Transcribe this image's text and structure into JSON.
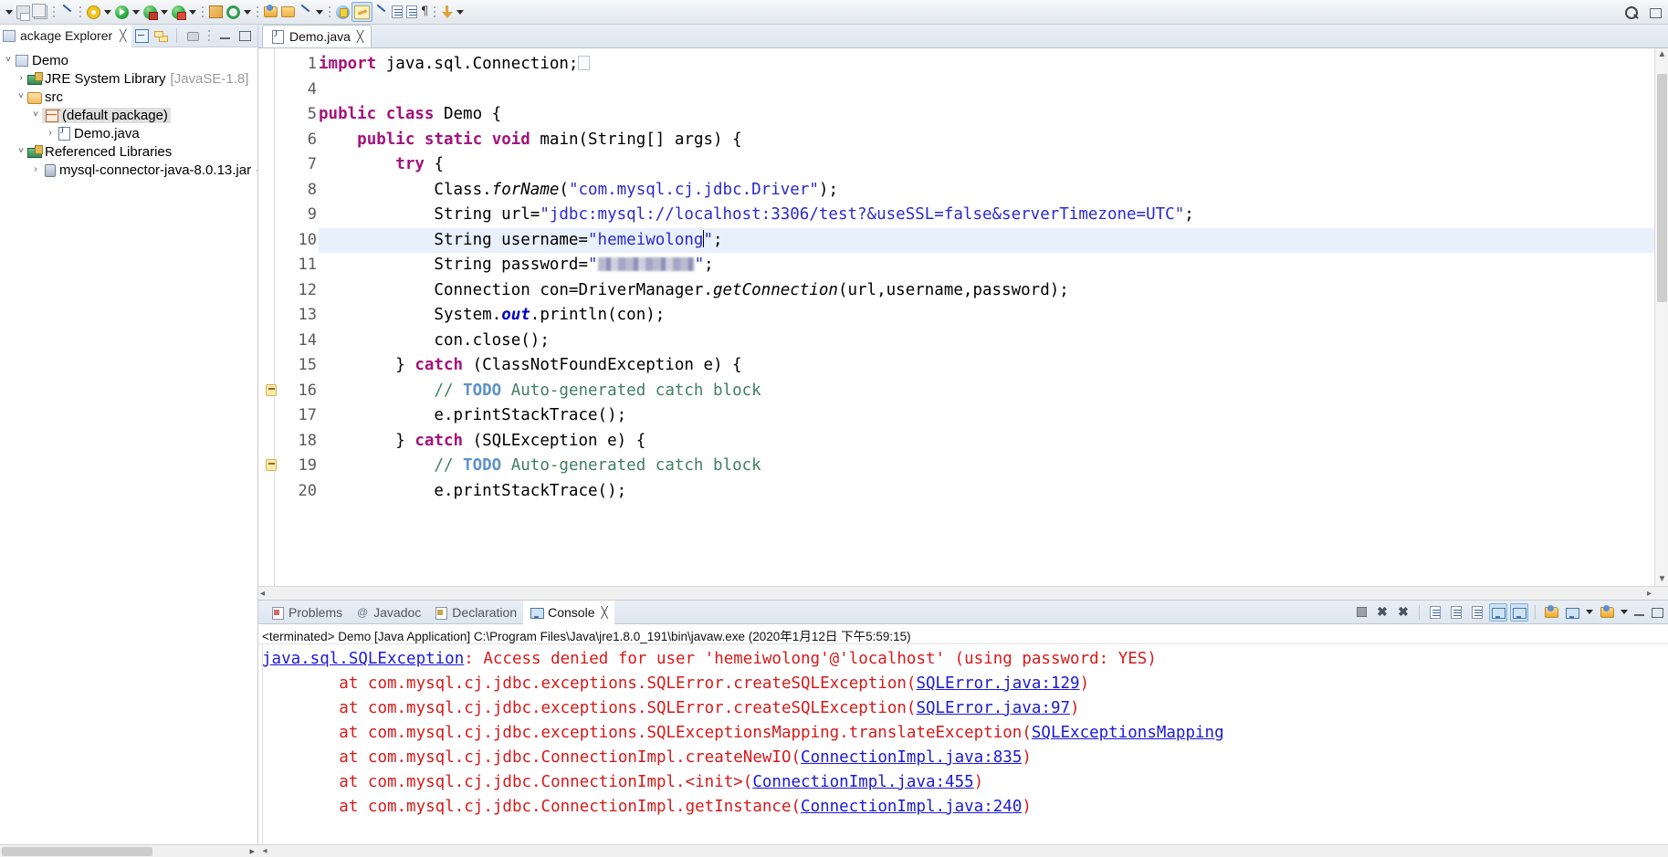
{
  "toolbar": {
    "icons": [
      {
        "name": "save-icon",
        "label": "Save"
      },
      {
        "name": "save-all-icon",
        "label": "Save All"
      },
      {
        "name": "skip-breakpoints-icon",
        "label": "Skip All Breakpoints"
      },
      {
        "name": "debug-icon",
        "label": "Debug"
      },
      {
        "name": "run-icon",
        "label": "Run"
      },
      {
        "name": "run-external-tools-icon",
        "label": "External Tools"
      },
      {
        "name": "coverage-icon",
        "label": "Coverage"
      },
      {
        "name": "new-java-package-icon",
        "label": "New Java Package"
      },
      {
        "name": "refresh-icon",
        "label": "Refresh"
      },
      {
        "name": "open-type-icon",
        "label": "Open Type"
      },
      {
        "name": "open-task-icon",
        "label": "Open Task"
      },
      {
        "name": "new-folder-icon",
        "label": "New Folder"
      },
      {
        "name": "edit-pen-icon",
        "label": "Edit"
      },
      {
        "name": "previous-annotation-icon",
        "label": "Previous Annotation"
      },
      {
        "name": "next-annotation-icon",
        "label": "Next Annotation"
      },
      {
        "name": "toggle-mark-occurrences-icon",
        "label": "Toggle Mark Occurrences"
      },
      {
        "name": "link-with-editor-icon",
        "label": "Link With Editor"
      },
      {
        "name": "show-whitespace-icon",
        "label": "Show Whitespace Characters"
      },
      {
        "name": "block-selection-icon",
        "label": "Block Selection Mode"
      },
      {
        "name": "pilcrow-icon",
        "label": "Show Print Margin"
      },
      {
        "name": "download-icon",
        "label": "Download"
      }
    ],
    "right_icons": [
      {
        "name": "search-icon",
        "label": "Search"
      },
      {
        "name": "perspective-icon",
        "label": "Open Perspective"
      }
    ]
  },
  "package_explorer": {
    "title": "ackage Explorer",
    "close_glyph": "╳",
    "tools": [
      {
        "name": "collapse-all-icon",
        "label": "Collapse All"
      },
      {
        "name": "link-with-editor-icon",
        "label": "Link with Editor"
      },
      {
        "name": "view-menu-icon",
        "label": "View Menu"
      },
      {
        "name": "minimize-icon",
        "label": "Minimize"
      },
      {
        "name": "maximize-icon",
        "label": "Maximize"
      }
    ],
    "tree": [
      {
        "indent": 1,
        "twist": "˅",
        "icon": "project-icon",
        "label": "Demo",
        "muted": "",
        "selected": false
      },
      {
        "indent": 2,
        "twist": "›",
        "icon": "jre-system-library-icon",
        "label": "JRE System Library",
        "muted": "[JavaSE-1.8]",
        "selected": false
      },
      {
        "indent": 2,
        "twist": "˅",
        "icon": "source-folder-icon",
        "label": "src",
        "muted": "",
        "selected": false
      },
      {
        "indent": 3,
        "twist": "˅",
        "icon": "package-icon",
        "label": "(default package)",
        "muted": "",
        "selected": true
      },
      {
        "indent": 4,
        "twist": "›",
        "icon": "java-file-icon",
        "label": "Demo.java",
        "muted": "",
        "selected": false
      },
      {
        "indent": 2,
        "twist": "˅",
        "icon": "referenced-libraries-icon",
        "label": "Referenced Libraries",
        "muted": "",
        "selected": false
      },
      {
        "indent": 3,
        "twist": "›",
        "icon": "jar-icon",
        "label": "mysql-connector-java-8.0.13.jar",
        "muted": "- C:\\L",
        "selected": false
      }
    ]
  },
  "editor": {
    "tab": {
      "label": "Demo.java",
      "icon": "java-file-icon",
      "close_glyph": "╳"
    },
    "lines": [
      {
        "num": "1",
        "fold": "⊕",
        "warn": false,
        "highlight": false
      },
      {
        "num": "4",
        "fold": "",
        "warn": false,
        "highlight": false
      },
      {
        "num": "5",
        "fold": "",
        "warn": false,
        "highlight": false
      },
      {
        "num": "6",
        "fold": "⊖",
        "warn": false,
        "highlight": false
      },
      {
        "num": "7",
        "fold": "",
        "warn": false,
        "highlight": false
      },
      {
        "num": "8",
        "fold": "",
        "warn": false,
        "highlight": false
      },
      {
        "num": "9",
        "fold": "",
        "warn": false,
        "highlight": false
      },
      {
        "num": "10",
        "fold": "",
        "warn": false,
        "highlight": true
      },
      {
        "num": "11",
        "fold": "",
        "warn": false,
        "highlight": false
      },
      {
        "num": "12",
        "fold": "",
        "warn": false,
        "highlight": false
      },
      {
        "num": "13",
        "fold": "",
        "warn": false,
        "highlight": false
      },
      {
        "num": "14",
        "fold": "",
        "warn": false,
        "highlight": false
      },
      {
        "num": "15",
        "fold": "",
        "warn": false,
        "highlight": false
      },
      {
        "num": "16",
        "fold": "",
        "warn": true,
        "highlight": false
      },
      {
        "num": "17",
        "fold": "",
        "warn": false,
        "highlight": false
      },
      {
        "num": "18",
        "fold": "",
        "warn": false,
        "highlight": false
      },
      {
        "num": "19",
        "fold": "",
        "warn": true,
        "highlight": false
      },
      {
        "num": "20",
        "fold": "",
        "warn": false,
        "highlight": false
      }
    ],
    "code_text": {
      "l1_kw": "import",
      "l1_rest": " java.sql.Connection;",
      "l5_kw1": "public",
      "l5_kw2": "class",
      "l5_name": " Demo {",
      "l6_indent": "    ",
      "l6_kw1": "public",
      "l6_kw2": "static",
      "l6_kw3": "void",
      "l6_rest": " main(String[] args) {",
      "l7": "        ",
      "l7_kw": "try",
      "l7_rest": " {",
      "l8_pre": "            Class.",
      "l8_method": "forName",
      "l8_open": "(",
      "l8_str": "\"com.mysql.cj.jdbc.Driver\"",
      "l8_end": ");",
      "l9_pre": "            String url=",
      "l9_str": "\"jdbc:mysql://localhost:3306/test?&useSSL=false&serverTimezone=UTC\"",
      "l9_end": ";",
      "l10_pre": "            String username=",
      "l10_str_a": "\"hemeiwolong",
      "l10_str_b": "\"",
      "l10_end": ";",
      "l11_pre": "            String password=",
      "l11_quote_open": "\"",
      "l11_quote_close": "\"",
      "l11_end": ";",
      "l12_pre": "            Connection con=DriverManager.",
      "l12_method": "getConnection",
      "l12_end": "(url,username,password);",
      "l13_pre": "            System.",
      "l13_field": "out",
      "l13_end": ".println(con);",
      "l14": "            con.close();",
      "l15_pre": "        } ",
      "l15_kw": "catch",
      "l15_rest": " (ClassNotFoundException e) {",
      "l16_indent": "            ",
      "l16_slashes": "// ",
      "l16_todo": "TODO",
      "l16_rest": " Auto-generated catch block",
      "l17": "            e.printStackTrace();",
      "l18_pre": "        } ",
      "l18_kw": "catch",
      "l18_rest": " (SQLException e) {",
      "l19_indent": "            ",
      "l19_slashes": "// ",
      "l19_todo": "TODO",
      "l19_rest": " Auto-generated catch block",
      "l20": "            e.printStackTrace();"
    }
  },
  "console": {
    "tabs": [
      {
        "name": "tab-problems",
        "label": "Problems",
        "icon": "problems-icon",
        "active": false
      },
      {
        "name": "tab-javadoc",
        "label": "Javadoc",
        "icon": "javadoc-icon",
        "active": false
      },
      {
        "name": "tab-declaration",
        "label": "Declaration",
        "icon": "declaration-icon",
        "active": false
      },
      {
        "name": "tab-console",
        "label": "Console",
        "icon": "console-icon",
        "active": true
      }
    ],
    "close_glyph": "╳",
    "tools": [
      {
        "name": "terminate-icon",
        "label": "Terminate",
        "active": false
      },
      {
        "name": "remove-launch-icon",
        "label": "Remove Launch",
        "active": false
      },
      {
        "name": "remove-all-terminated-icon",
        "label": "Remove All Terminated Launches",
        "active": false
      },
      {
        "name": "clear-console-icon",
        "label": "Clear Console",
        "active": false
      },
      {
        "name": "scroll-lock-icon",
        "label": "Scroll Lock",
        "active": false
      },
      {
        "name": "word-wrap-icon",
        "label": "Word Wrap",
        "active": false
      },
      {
        "name": "show-console-on-output-icon",
        "label": "Show Console When Standard Out Changes",
        "active": true
      },
      {
        "name": "show-console-on-error-icon",
        "label": "Show Console When Standard Error Changes",
        "active": true
      },
      {
        "name": "pin-console-icon",
        "label": "Pin Console",
        "active": false
      },
      {
        "name": "display-selected-console-icon",
        "label": "Display Selected Console",
        "active": false
      },
      {
        "name": "open-console-icon",
        "label": "Open Console",
        "active": false
      },
      {
        "name": "minimize-icon",
        "label": "Minimize",
        "active": false
      },
      {
        "name": "maximize-icon",
        "label": "Maximize",
        "active": false
      }
    ],
    "status": "<terminated> Demo [Java Application] C:\\Program Files\\Java\\jre1.8.0_191\\bin\\javaw.exe (2020年1月12日 下午5:59:15)",
    "output": [
      {
        "type": "header",
        "link": "java.sql.SQLException",
        "text": ": Access denied for user 'hemeiwolong'@'localhost' (using password: YES)"
      },
      {
        "type": "frame",
        "text": "\tat com.mysql.cj.jdbc.exceptions.SQLError.createSQLException(",
        "link": "SQLError.java:129",
        "tail": ")"
      },
      {
        "type": "frame",
        "text": "\tat com.mysql.cj.jdbc.exceptions.SQLError.createSQLException(",
        "link": "SQLError.java:97",
        "tail": ")"
      },
      {
        "type": "frame",
        "text": "\tat com.mysql.cj.jdbc.exceptions.SQLExceptionsMapping.translateException(",
        "link": "SQLExceptionsMapping",
        "tail": ""
      },
      {
        "type": "frame",
        "text": "\tat com.mysql.cj.jdbc.ConnectionImpl.createNewIO(",
        "link": "ConnectionImpl.java:835",
        "tail": ")"
      },
      {
        "type": "frame",
        "text": "\tat com.mysql.cj.jdbc.ConnectionImpl.<init>(",
        "link": "ConnectionImpl.java:455",
        "tail": ")"
      },
      {
        "type": "frame",
        "text": "\tat com.mysql.cj.jdbc.ConnectionImpl.getInstance(",
        "link": "ConnectionImpl.java:240",
        "tail": ")"
      }
    ]
  },
  "colors": {
    "keyword": "#a3127c",
    "string": "#2a2ad0",
    "comment": "#3f7f5f",
    "todo": "#5f92c9",
    "error": "#d61a1a",
    "link": "#1a1ad6",
    "selection": "#e8f0fc",
    "accent": "#cde2f5"
  }
}
